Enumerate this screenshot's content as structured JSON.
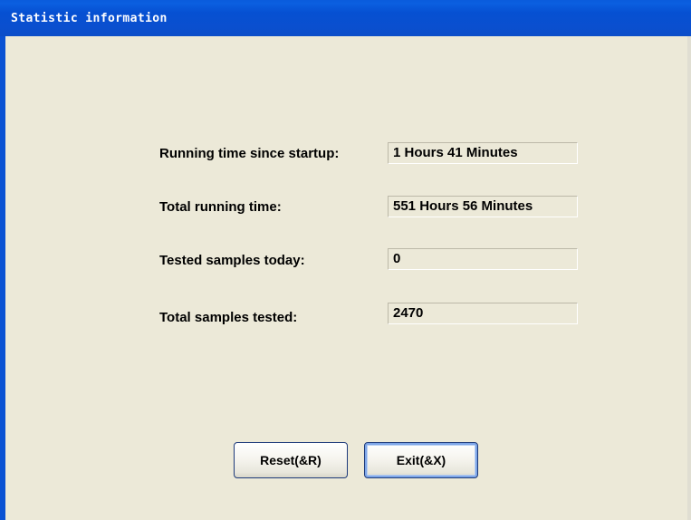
{
  "window": {
    "title": "Statistic information"
  },
  "stats": [
    {
      "label": "Running time since startup:",
      "value": "1 Hours 41 Minutes"
    },
    {
      "label": "Total running time:",
      "value": "551 Hours 56 Minutes"
    },
    {
      "label": "Tested samples today:",
      "value": "0"
    },
    {
      "label": "Total samples tested:",
      "value": "2470"
    }
  ],
  "buttons": {
    "reset_label": "Reset(&R)",
    "exit_label": "Exit(&X)"
  },
  "colors": {
    "titlebar": "#0a52d3",
    "dialog_background": "#ece9d8",
    "button_border": "#1d3a7a"
  }
}
